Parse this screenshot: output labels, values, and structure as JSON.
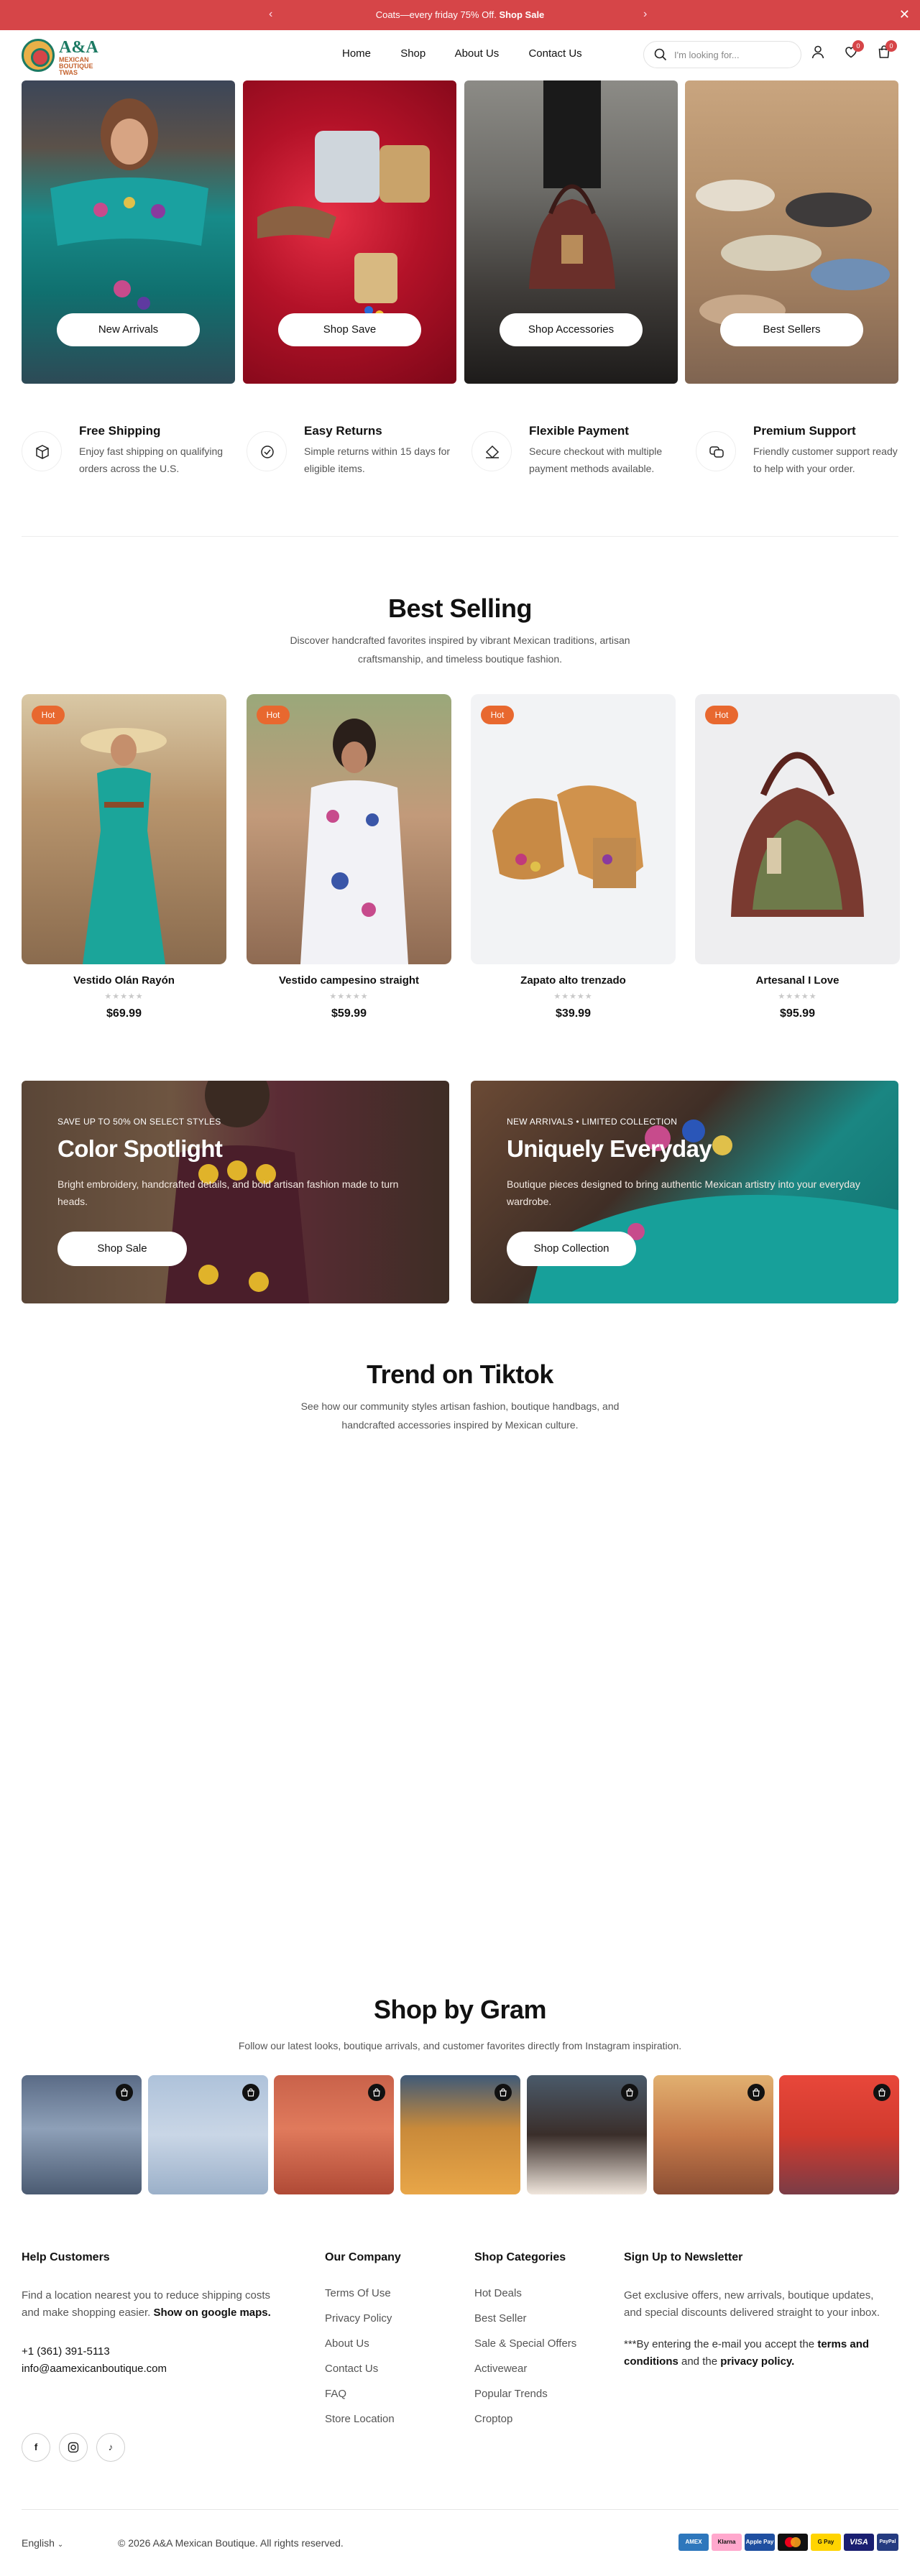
{
  "announcement": {
    "text": "Coats—every friday 75% Off.",
    "link": "Shop Sale",
    "prev": "‹",
    "next": "›",
    "close": "✕"
  },
  "header": {
    "logo_text": "A&A",
    "logo_subtext": "MEXICAN BOUTIQUE TWAS",
    "nav": [
      "Home",
      "Shop",
      "About Us",
      "Contact Us"
    ],
    "search_placeholder": "I'm looking for...",
    "wishlist_count": "0",
    "cart_count": "0"
  },
  "hero_tiles": [
    {
      "label": "New Arrivals"
    },
    {
      "label": "Shop Save"
    },
    {
      "label": "Shop Accessories"
    },
    {
      "label": "Best Sellers"
    }
  ],
  "features": [
    {
      "title": "Free Shipping",
      "desc": "Enjoy fast shipping on qualifying orders across the U.S.",
      "icon": "box-icon"
    },
    {
      "title": "Easy Returns",
      "desc": "Simple returns within 15 days for eligible items.",
      "icon": "check-circle-icon"
    },
    {
      "title": "Flexible Payment",
      "desc": "Secure checkout with multiple payment methods available.",
      "icon": "payment-icon"
    },
    {
      "title": "Premium Support",
      "desc": "Friendly customer support ready to help with your order.",
      "icon": "chat-icon"
    }
  ],
  "best_selling": {
    "title": "Best Selling",
    "subtitle": "Discover handcrafted favorites inspired by vibrant Mexican traditions, artisan craftsmanship, and timeless boutique fashion.",
    "products": [
      {
        "badge": "Hot",
        "name": "Vestido Olán Rayón",
        "price": "$69.99",
        "stars": "★★★★★"
      },
      {
        "badge": "Hot",
        "name": "Vestido campesino straight",
        "price": "$59.99",
        "stars": "★★★★★"
      },
      {
        "badge": "Hot",
        "name": "Zapato alto trenzado",
        "price": "$39.99",
        "stars": "★★★★★"
      },
      {
        "badge": "Hot",
        "name": "Artesanal I Love",
        "price": "$95.99",
        "stars": "★★★★★"
      }
    ]
  },
  "banners": [
    {
      "eyebrow": "SAVE UP TO 50% ON SELECT STYLES",
      "title": "Color Spotlight",
      "text": "Bright embroidery, handcrafted details, and bold artisan fashion made to turn heads.",
      "button": "Shop Sale"
    },
    {
      "eyebrow": "NEW ARRIVALS • LIMITED COLLECTION",
      "title": "Uniquely Everyday",
      "text": "Boutique pieces designed to bring authentic Mexican artistry into your everyday wardrobe.",
      "button": "Shop Collection"
    }
  ],
  "tiktok": {
    "title": "Trend on Tiktok",
    "subtitle": "See how our community styles artisan fashion, boutique handbags, and handcrafted accessories inspired by Mexican culture."
  },
  "gram": {
    "title": "Shop by Gram",
    "subtitle": "Follow our latest looks, boutique arrivals, and customer favorites directly from Instagram inspiration."
  },
  "footer": {
    "help": {
      "heading": "Help Customers",
      "text": "Find a location nearest you to reduce shipping costs and make shopping easier.",
      "maps_link": "Show on google maps.",
      "phone": "+1 (361) 391-5113",
      "email": "info@aamexicanboutique.com"
    },
    "company": {
      "heading": "Our Company",
      "links": [
        "Terms Of Use",
        "Privacy Policy",
        "About Us",
        "Contact Us",
        "FAQ",
        "Store Location"
      ]
    },
    "categories": {
      "heading": "Shop Categories",
      "links": [
        "Hot Deals",
        "Best Seller",
        "Sale & Special Offers",
        "Activewear",
        "Popular Trends",
        "Croptop"
      ]
    },
    "newsletter": {
      "heading": "Sign Up to Newsletter",
      "text": "Get exclusive offers, new arrivals, boutique updates, and special discounts delivered straight to your inbox.",
      "consent_pre": "***By entering the e-mail you accept the",
      "terms": "terms and conditions",
      "and": "and the",
      "privacy": "privacy policy."
    },
    "language": "English",
    "copyright": "© 2026 A&A Mexican Boutique. All rights reserved.",
    "payments": [
      "AMEX",
      "Klarna",
      "Apple Pay",
      "MC",
      "G Pay",
      "VISA",
      "PayPal"
    ]
  }
}
